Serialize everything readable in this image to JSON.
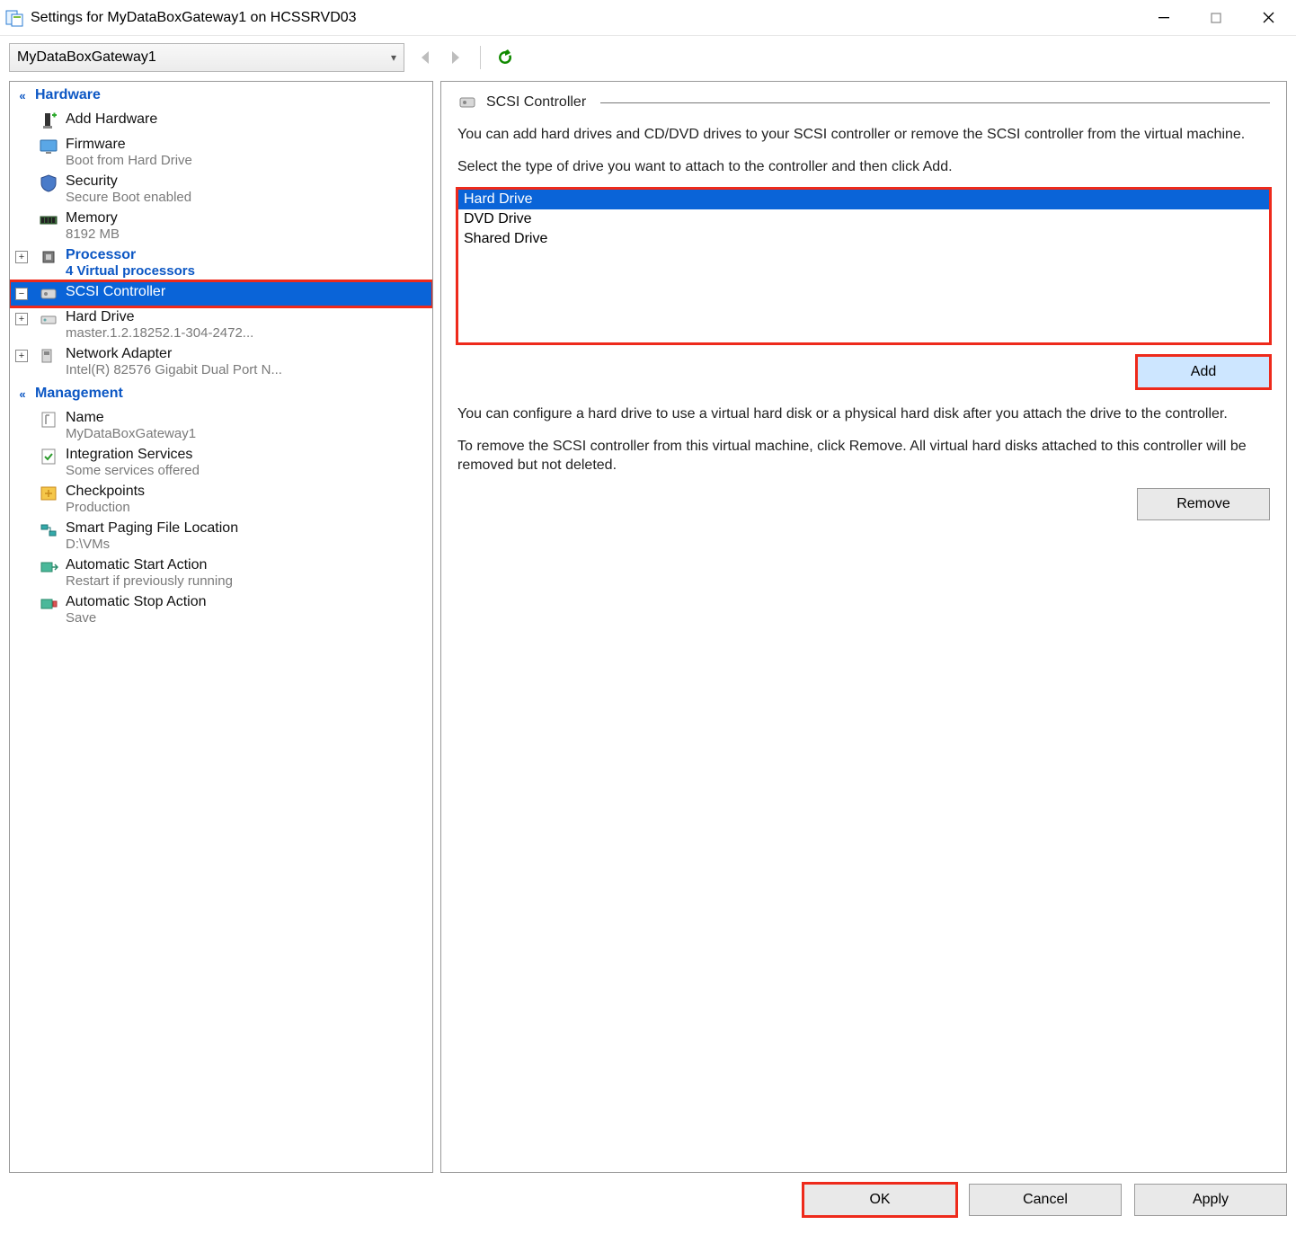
{
  "window": {
    "title": "Settings for MyDataBoxGateway1 on HCSSRVD03"
  },
  "toolbar": {
    "vm_name": "MyDataBoxGateway1"
  },
  "sidebar": {
    "section_hardware": "Hardware",
    "section_management": "Management",
    "add_hardware": {
      "label": "Add Hardware"
    },
    "firmware": {
      "label": "Firmware",
      "sub": "Boot from Hard Drive"
    },
    "security": {
      "label": "Security",
      "sub": "Secure Boot enabled"
    },
    "memory": {
      "label": "Memory",
      "sub": "8192 MB"
    },
    "processor": {
      "label": "Processor",
      "sub": "4 Virtual processors"
    },
    "scsi": {
      "label": "SCSI Controller"
    },
    "harddrive": {
      "label": "Hard Drive",
      "sub": "master.1.2.18252.1-304-2472..."
    },
    "netadapter": {
      "label": "Network Adapter",
      "sub": "Intel(R) 82576 Gigabit Dual Port N..."
    },
    "name": {
      "label": "Name",
      "sub": "MyDataBoxGateway1"
    },
    "integ": {
      "label": "Integration Services",
      "sub": "Some services offered"
    },
    "checkpoints": {
      "label": "Checkpoints",
      "sub": "Production"
    },
    "paging": {
      "label": "Smart Paging File Location",
      "sub": "D:\\VMs"
    },
    "autostart": {
      "label": "Automatic Start Action",
      "sub": "Restart if previously running"
    },
    "autostop": {
      "label": "Automatic Stop Action",
      "sub": "Save"
    }
  },
  "panel": {
    "title": "SCSI Controller",
    "desc1": "You can add hard drives and CD/DVD drives to your SCSI controller or remove the SCSI controller from the virtual machine.",
    "desc2": "Select the type of drive you want to attach to the controller and then click Add.",
    "drives": {
      "opt1": "Hard Drive",
      "opt2": "DVD Drive",
      "opt3": "Shared Drive"
    },
    "add_label": "Add",
    "desc3": "You can configure a hard drive to use a virtual hard disk or a physical hard disk after you attach the drive to the controller.",
    "desc4": "To remove the SCSI controller from this virtual machine, click Remove. All virtual hard disks attached to this controller will be removed but not deleted.",
    "remove_label": "Remove"
  },
  "footer": {
    "ok": "OK",
    "cancel": "Cancel",
    "apply": "Apply"
  }
}
